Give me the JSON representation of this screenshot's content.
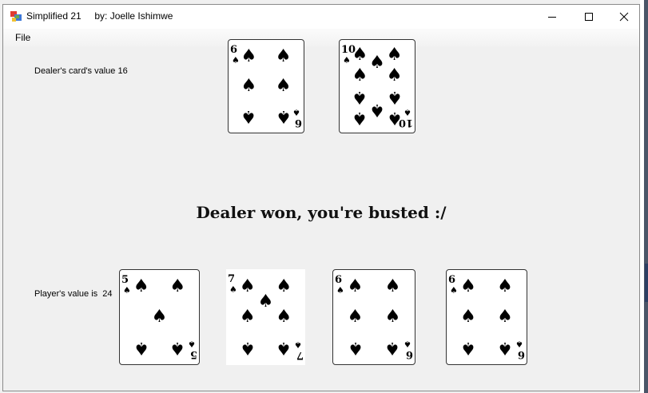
{
  "window": {
    "title": "Simplified 21     by: Joelle Ishimwe",
    "menu": {
      "file": "File"
    }
  },
  "dealer": {
    "value_label": "Dealer's card's value 16",
    "cards": [
      {
        "rank": "6",
        "suit": "spades"
      },
      {
        "rank": "10",
        "suit": "spades"
      }
    ]
  },
  "player": {
    "value_label": "Player's value is  24",
    "cards": [
      {
        "rank": "5",
        "suit": "spades"
      },
      {
        "rank": "7",
        "suit": "spades"
      },
      {
        "rank": "6",
        "suit": "spades"
      },
      {
        "rank": "6",
        "suit": "spades"
      }
    ]
  },
  "status_message": "Dealer won, you're busted :/",
  "icons": {
    "suit_glyph": "spade-icon"
  },
  "colors": {
    "titlebar": "#ffffff",
    "background": "#f0f0f0",
    "card_face": "#ffffff",
    "suit": "#000000"
  }
}
